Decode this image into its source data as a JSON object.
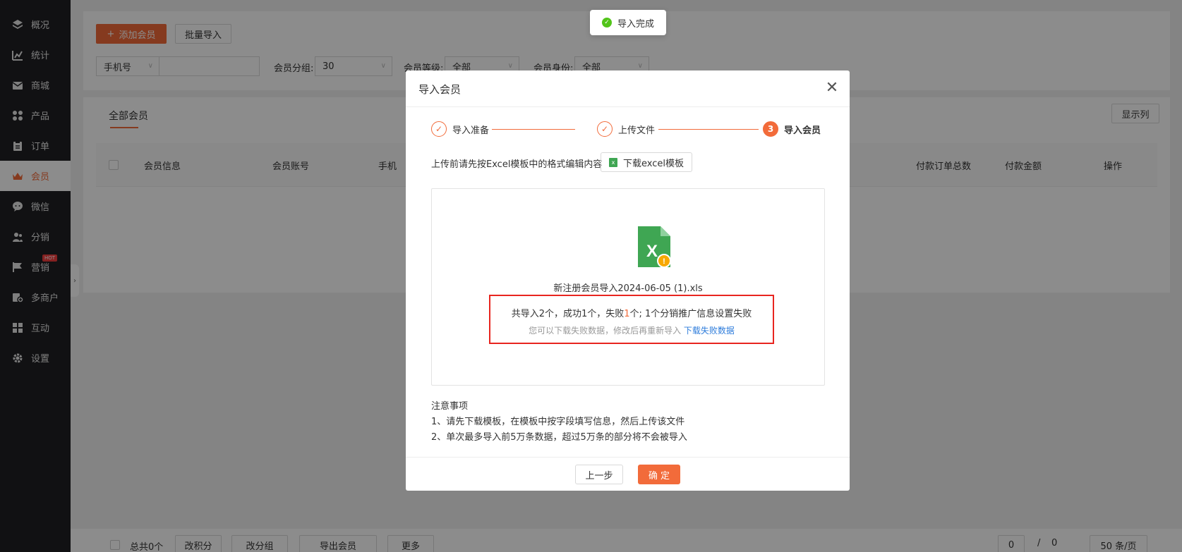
{
  "sidebar": {
    "items": [
      {
        "label": "概况",
        "icon": "layers-icon"
      },
      {
        "label": "统计",
        "icon": "chart-icon"
      },
      {
        "label": "商城",
        "icon": "mail-icon"
      },
      {
        "label": "产品",
        "icon": "grid-icon"
      },
      {
        "label": "订单",
        "icon": "clipboard-icon"
      },
      {
        "label": "会员",
        "icon": "crown-icon"
      },
      {
        "label": "微信",
        "icon": "chat-icon"
      },
      {
        "label": "分销",
        "icon": "users-icon"
      },
      {
        "label": "营销",
        "icon": "flag-icon",
        "badge": "HOT"
      },
      {
        "label": "多商户",
        "icon": "shop-icon"
      },
      {
        "label": "互动",
        "icon": "puzzle-icon"
      },
      {
        "label": "设置",
        "icon": "gear-icon"
      }
    ],
    "active_index": 5,
    "collapse_glyph": "›"
  },
  "toolbar": {
    "add_member": "添加会员",
    "batch_import": "批量导入"
  },
  "filters": {
    "phone_select": "手机号",
    "group_label": "会员分组:",
    "group_value": "30",
    "level_label": "会员等级:",
    "level_value": "全部",
    "identity_label": "会员身份:",
    "identity_value": "全部"
  },
  "tabs": {
    "all_members": "全部会员",
    "display_columns": "显示列"
  },
  "table": {
    "headers": [
      "会员信息",
      "会员账号",
      "手机",
      "付款订单总数",
      "付款金额",
      "操作"
    ]
  },
  "footer_bar": {
    "total": "总共0个",
    "change_points": "改积分",
    "change_group": "改分组",
    "export_members": "导出会员",
    "more": "更多",
    "page_current": "0",
    "page_sep": "/",
    "page_total": "0",
    "page_size": "50 条/页"
  },
  "toast": {
    "message": "导入完成"
  },
  "modal": {
    "title": "导入会员",
    "steps": [
      {
        "label": "导入准备",
        "state": "done"
      },
      {
        "label": "上传文件",
        "state": "done"
      },
      {
        "label": "导入会员",
        "state": "active",
        "number": "3"
      }
    ],
    "tip": "上传前请先按Excel模板中的格式编辑内容",
    "download_template": "下载excel模板",
    "file_name": "新注册会员导入2024-06-05 (1).xls",
    "result_prefix": "共导入2个，成功1个，失败",
    "result_fail_count": "1",
    "result_suffix": "个; 1个分销推广信息设置失败",
    "result_hint": "您可以下载失败数据，修改后再重新导入",
    "download_failed": "下载失败数据",
    "notes_title": "注意事项",
    "notes": [
      "1、请先下载模板，在模板中按字段填写信息，然后上传该文件",
      "2、单次最多导入前5万条数据，超过5万条的部分将不会被导入"
    ],
    "prev_button": "上一步",
    "confirm_button": "确 定"
  },
  "colors": {
    "accent": "#f26b3a",
    "sidebar_bg": "#1f2024",
    "error_border": "#e8251f",
    "link": "#2d7cdb",
    "success": "#52c41a",
    "excel_green": "#3fa653"
  }
}
